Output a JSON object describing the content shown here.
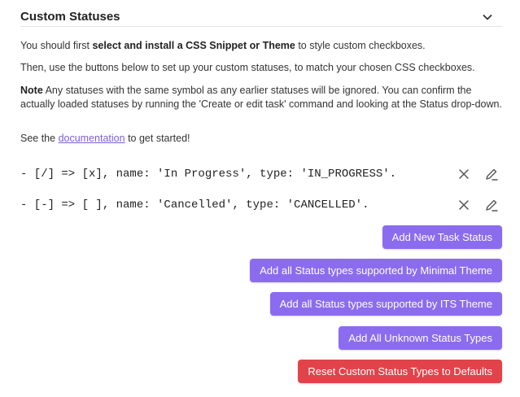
{
  "section": {
    "title": "Custom Statuses"
  },
  "intro": {
    "p1_before": "You should first ",
    "p1_bold": "select and install a CSS Snippet or Theme",
    "p1_after": " to style custom checkboxes.",
    "p2": "Then, use the buttons below to set up your custom statuses, to match your chosen CSS checkboxes.",
    "p3_bold": "Note",
    "p3_rest": " Any statuses with the same symbol as any earlier statuses will be ignored. You can confirm the actually loaded statuses by running the 'Create or edit task' command and looking at the Status drop-down.",
    "p4_before": "See the ",
    "p4_link": "documentation",
    "p4_after": " to get started!"
  },
  "statuses": [
    {
      "text": "- [/] => [x], name: 'In Progress', type: 'IN_PROGRESS'."
    },
    {
      "text": "- [-] => [ ], name: 'Cancelled', type: 'CANCELLED'."
    }
  ],
  "buttons": {
    "add_new": "Add New Task Status",
    "add_minimal": "Add all Status types supported by Minimal Theme",
    "add_its": "Add all Status types supported by ITS Theme",
    "add_unknown": "Add All Unknown Status Types",
    "reset": "Reset Custom Status Types to Defaults"
  },
  "colors": {
    "accent": "#8b6cef",
    "danger": "#e2434a",
    "link": "#7a5fd6"
  },
  "icons": {
    "collapse": "chevron-down-icon",
    "remove": "close-icon",
    "edit": "pencil-icon"
  }
}
